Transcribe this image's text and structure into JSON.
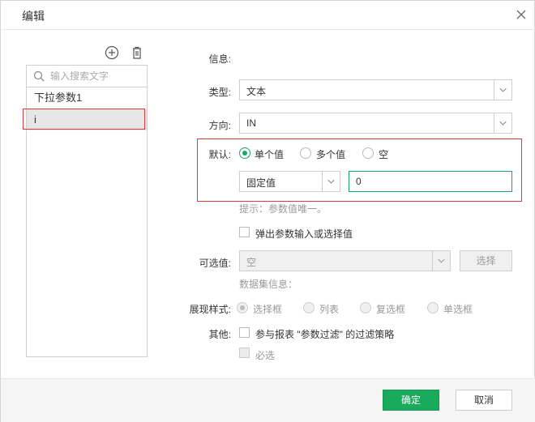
{
  "dialog": {
    "title": "编辑"
  },
  "left": {
    "search_placeholder": "输入搜索文字",
    "params": [
      {
        "label": "下拉参数1"
      },
      {
        "label": "i"
      }
    ]
  },
  "form": {
    "info_label": "信息:",
    "type_label": "类型:",
    "type_value": "文本",
    "direction_label": "方向:",
    "direction_value": "IN",
    "default_label": "默认:",
    "default_options": [
      "单个值",
      "多个值",
      "空"
    ],
    "default_mode_value": "固定值",
    "default_value": "0",
    "hint": "提示：参数值唯一。",
    "popup_label": "弹出参数输入或选择值",
    "options_label": "可选值:",
    "options_value": "空",
    "choose_button": "选择",
    "dataset_info": "数据集信息：",
    "style_label": "展现样式:",
    "style_options": [
      "选择框",
      "列表",
      "复选框",
      "单选框"
    ],
    "other_label": "其他:",
    "filter_label": "参与报表 \"参数过滤\" 的过滤策略",
    "required_label": "必选"
  },
  "footer": {
    "ok": "确定",
    "cancel": "取消"
  },
  "colors": {
    "accent": "#1aaa5c",
    "highlight": "#e03a3a"
  }
}
